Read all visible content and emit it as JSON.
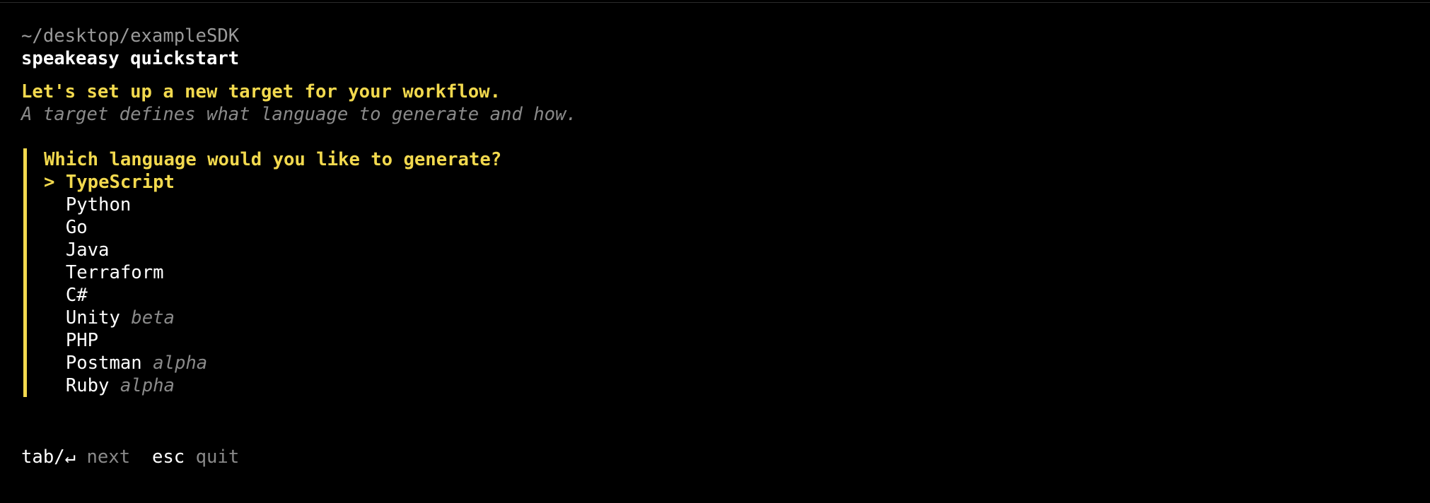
{
  "session": {
    "cwd": "~/desktop/exampleSDK",
    "command": "speakeasy quickstart"
  },
  "intro": {
    "heading": "Let's set up a new target for your workflow.",
    "subtitle": "A target defines what language to generate and how."
  },
  "prompt": {
    "question": "Which language would you like to generate?",
    "cursor": ">",
    "options": [
      {
        "label": "TypeScript",
        "tag": "",
        "selected": true
      },
      {
        "label": "Python",
        "tag": ""
      },
      {
        "label": "Go",
        "tag": ""
      },
      {
        "label": "Java",
        "tag": ""
      },
      {
        "label": "Terraform",
        "tag": ""
      },
      {
        "label": "C#",
        "tag": ""
      },
      {
        "label": "Unity",
        "tag": "beta"
      },
      {
        "label": "PHP",
        "tag": ""
      },
      {
        "label": "Postman",
        "tag": "alpha"
      },
      {
        "label": "Ruby",
        "tag": "alpha"
      }
    ]
  },
  "footer": {
    "next_key": "tab/↵",
    "next_label": "next",
    "quit_key": "esc",
    "quit_label": "quit"
  },
  "colors": {
    "background": "#000000",
    "accent": "#f2d94e",
    "muted": "#8a8a8a",
    "text": "#ffffff"
  }
}
